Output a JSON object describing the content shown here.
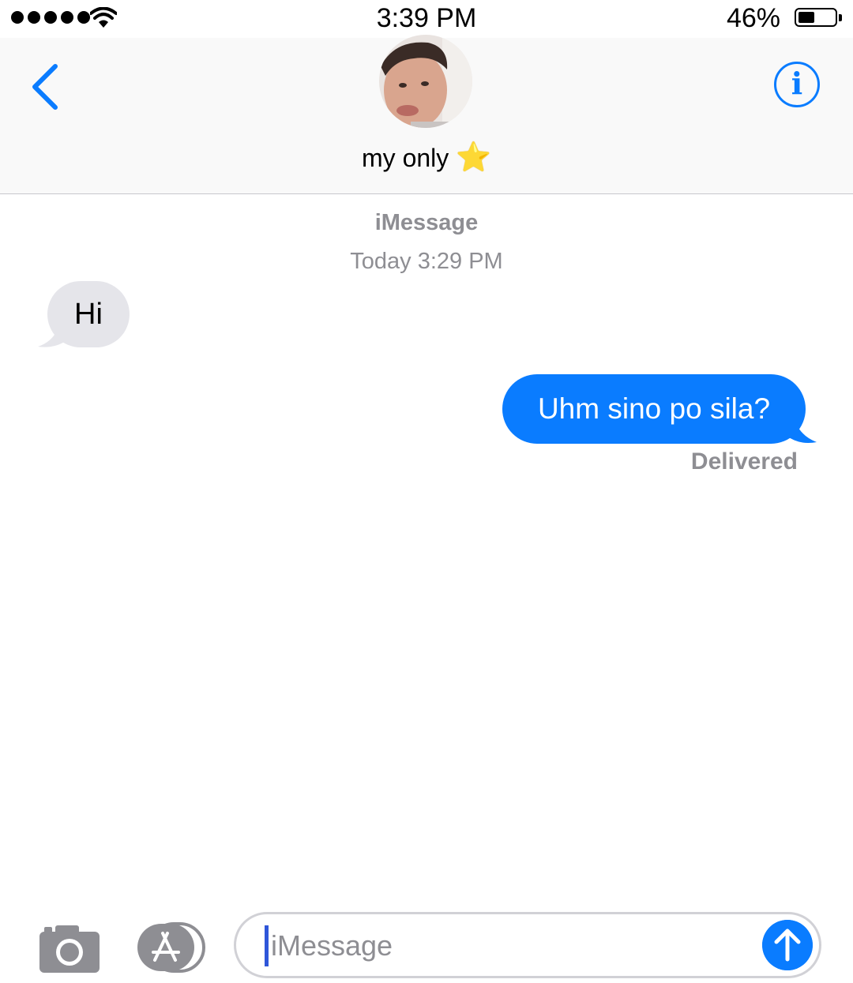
{
  "status_bar": {
    "time": "3:39 PM",
    "battery_percent": "46%",
    "battery_level": 0.46,
    "signal_dots": 5
  },
  "header": {
    "contact_name": "my only",
    "contact_emoji": "⭐"
  },
  "thread": {
    "service_label": "iMessage",
    "timestamp": "Today 3:29 PM",
    "messages": [
      {
        "direction": "incoming",
        "text": "Hi"
      },
      {
        "direction": "outgoing",
        "text": "Uhm sino po sila?",
        "status": "Delivered"
      }
    ]
  },
  "input": {
    "placeholder": "iMessage",
    "value": ""
  },
  "colors": {
    "accent": "#0a7cff",
    "incoming_bubble": "#e5e5ea",
    "secondary_text": "#8e8e93"
  },
  "icons": [
    "wifi-icon",
    "battery-icon",
    "back-chevron-icon",
    "info-icon",
    "camera-icon",
    "app-store-icon",
    "send-arrow-icon"
  ]
}
